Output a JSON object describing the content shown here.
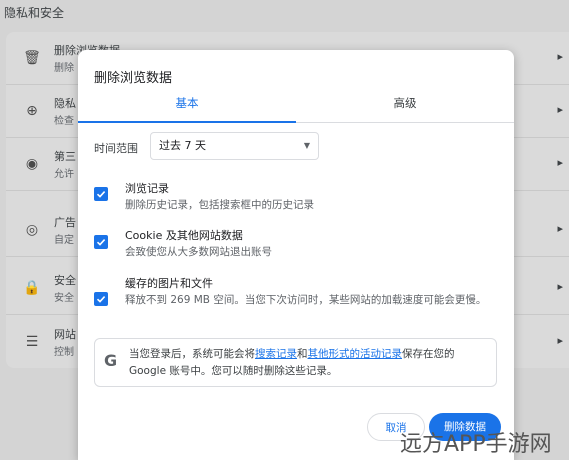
{
  "background": {
    "section_title": "隐私和安全",
    "rows": [
      {
        "icon": "trash-icon",
        "glyph": "🗑",
        "label": "删除浏览数据",
        "sub": "删除"
      },
      {
        "icon": "privacy-guide-icon",
        "glyph": "⊕",
        "label": "隐私",
        "sub": "检查"
      },
      {
        "icon": "cookie-icon",
        "glyph": "◉",
        "label": "第三",
        "sub": "允许"
      },
      {
        "icon": "ads-icon",
        "glyph": "◎",
        "label": "广告",
        "sub": "自定"
      },
      {
        "icon": "lock-icon",
        "glyph": "🔒",
        "label": "安全",
        "sub": "安全"
      },
      {
        "icon": "sliders-icon",
        "glyph": "☰",
        "label": "网站",
        "sub": "控制"
      }
    ]
  },
  "dialog": {
    "title": "删除浏览数据",
    "tabs": {
      "basic": "基本",
      "advanced": "高级"
    },
    "time_range": {
      "label": "时间范围",
      "value": "过去 7 天"
    },
    "options": [
      {
        "title": "浏览记录",
        "desc": "删除历史记录，包括搜索框中的历史记录",
        "checked": true
      },
      {
        "title": "Cookie 及其他网站数据",
        "desc": "会致使您从大多数网站退出账号",
        "checked": true
      },
      {
        "title": "缓存的图片和文件",
        "desc": "释放不到 269 MB 空间。当您下次访问时，某些网站的加载速度可能会更慢。",
        "checked": true
      }
    ],
    "info": {
      "part1": "当您登录后，系统可能会将",
      "link1": "搜索记录",
      "part2": "和",
      "link2": "其他形式的活动记录",
      "part3": "保存在您的 Google 账号中。您可以随时删除这些记录。"
    },
    "buttons": {
      "cancel": "取消",
      "confirm": "删除数据"
    }
  },
  "watermark": "远方APP手游网",
  "colors": {
    "accent": "#1a73e8",
    "overlay": "#d4d4d4"
  }
}
